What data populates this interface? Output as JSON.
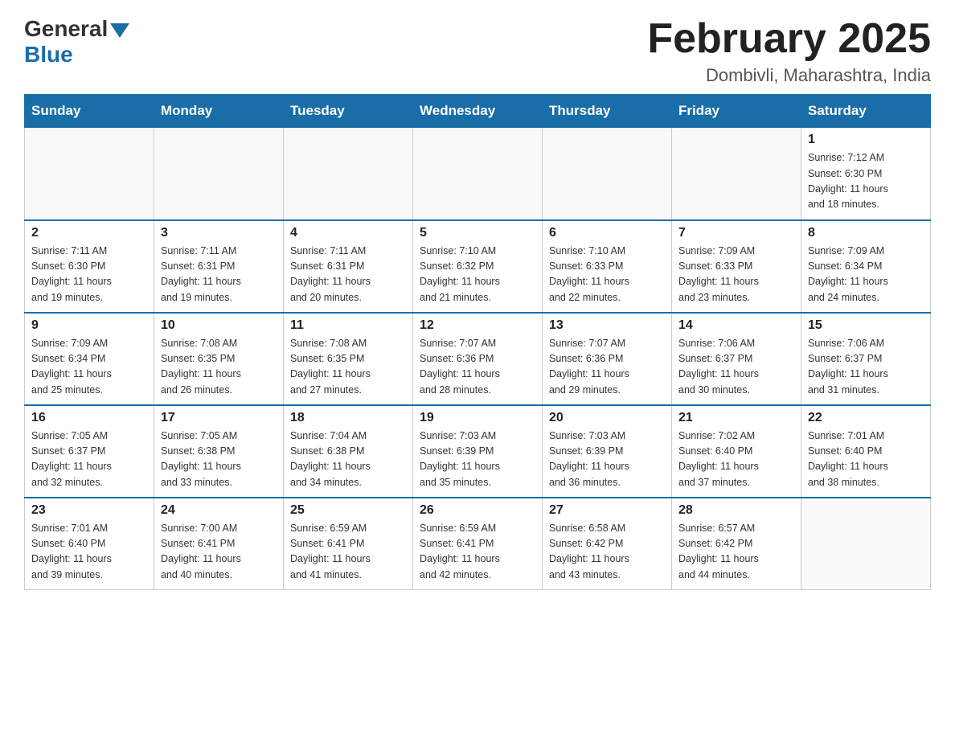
{
  "header": {
    "logo_general": "General",
    "logo_blue": "Blue",
    "month_title": "February 2025",
    "location": "Dombivli, Maharashtra, India"
  },
  "weekdays": [
    "Sunday",
    "Monday",
    "Tuesday",
    "Wednesday",
    "Thursday",
    "Friday",
    "Saturday"
  ],
  "weeks": [
    [
      {
        "day": "",
        "info": ""
      },
      {
        "day": "",
        "info": ""
      },
      {
        "day": "",
        "info": ""
      },
      {
        "day": "",
        "info": ""
      },
      {
        "day": "",
        "info": ""
      },
      {
        "day": "",
        "info": ""
      },
      {
        "day": "1",
        "info": "Sunrise: 7:12 AM\nSunset: 6:30 PM\nDaylight: 11 hours\nand 18 minutes."
      }
    ],
    [
      {
        "day": "2",
        "info": "Sunrise: 7:11 AM\nSunset: 6:30 PM\nDaylight: 11 hours\nand 19 minutes."
      },
      {
        "day": "3",
        "info": "Sunrise: 7:11 AM\nSunset: 6:31 PM\nDaylight: 11 hours\nand 19 minutes."
      },
      {
        "day": "4",
        "info": "Sunrise: 7:11 AM\nSunset: 6:31 PM\nDaylight: 11 hours\nand 20 minutes."
      },
      {
        "day": "5",
        "info": "Sunrise: 7:10 AM\nSunset: 6:32 PM\nDaylight: 11 hours\nand 21 minutes."
      },
      {
        "day": "6",
        "info": "Sunrise: 7:10 AM\nSunset: 6:33 PM\nDaylight: 11 hours\nand 22 minutes."
      },
      {
        "day": "7",
        "info": "Sunrise: 7:09 AM\nSunset: 6:33 PM\nDaylight: 11 hours\nand 23 minutes."
      },
      {
        "day": "8",
        "info": "Sunrise: 7:09 AM\nSunset: 6:34 PM\nDaylight: 11 hours\nand 24 minutes."
      }
    ],
    [
      {
        "day": "9",
        "info": "Sunrise: 7:09 AM\nSunset: 6:34 PM\nDaylight: 11 hours\nand 25 minutes."
      },
      {
        "day": "10",
        "info": "Sunrise: 7:08 AM\nSunset: 6:35 PM\nDaylight: 11 hours\nand 26 minutes."
      },
      {
        "day": "11",
        "info": "Sunrise: 7:08 AM\nSunset: 6:35 PM\nDaylight: 11 hours\nand 27 minutes."
      },
      {
        "day": "12",
        "info": "Sunrise: 7:07 AM\nSunset: 6:36 PM\nDaylight: 11 hours\nand 28 minutes."
      },
      {
        "day": "13",
        "info": "Sunrise: 7:07 AM\nSunset: 6:36 PM\nDaylight: 11 hours\nand 29 minutes."
      },
      {
        "day": "14",
        "info": "Sunrise: 7:06 AM\nSunset: 6:37 PM\nDaylight: 11 hours\nand 30 minutes."
      },
      {
        "day": "15",
        "info": "Sunrise: 7:06 AM\nSunset: 6:37 PM\nDaylight: 11 hours\nand 31 minutes."
      }
    ],
    [
      {
        "day": "16",
        "info": "Sunrise: 7:05 AM\nSunset: 6:37 PM\nDaylight: 11 hours\nand 32 minutes."
      },
      {
        "day": "17",
        "info": "Sunrise: 7:05 AM\nSunset: 6:38 PM\nDaylight: 11 hours\nand 33 minutes."
      },
      {
        "day": "18",
        "info": "Sunrise: 7:04 AM\nSunset: 6:38 PM\nDaylight: 11 hours\nand 34 minutes."
      },
      {
        "day": "19",
        "info": "Sunrise: 7:03 AM\nSunset: 6:39 PM\nDaylight: 11 hours\nand 35 minutes."
      },
      {
        "day": "20",
        "info": "Sunrise: 7:03 AM\nSunset: 6:39 PM\nDaylight: 11 hours\nand 36 minutes."
      },
      {
        "day": "21",
        "info": "Sunrise: 7:02 AM\nSunset: 6:40 PM\nDaylight: 11 hours\nand 37 minutes."
      },
      {
        "day": "22",
        "info": "Sunrise: 7:01 AM\nSunset: 6:40 PM\nDaylight: 11 hours\nand 38 minutes."
      }
    ],
    [
      {
        "day": "23",
        "info": "Sunrise: 7:01 AM\nSunset: 6:40 PM\nDaylight: 11 hours\nand 39 minutes."
      },
      {
        "day": "24",
        "info": "Sunrise: 7:00 AM\nSunset: 6:41 PM\nDaylight: 11 hours\nand 40 minutes."
      },
      {
        "day": "25",
        "info": "Sunrise: 6:59 AM\nSunset: 6:41 PM\nDaylight: 11 hours\nand 41 minutes."
      },
      {
        "day": "26",
        "info": "Sunrise: 6:59 AM\nSunset: 6:41 PM\nDaylight: 11 hours\nand 42 minutes."
      },
      {
        "day": "27",
        "info": "Sunrise: 6:58 AM\nSunset: 6:42 PM\nDaylight: 11 hours\nand 43 minutes."
      },
      {
        "day": "28",
        "info": "Sunrise: 6:57 AM\nSunset: 6:42 PM\nDaylight: 11 hours\nand 44 minutes."
      },
      {
        "day": "",
        "info": ""
      }
    ]
  ]
}
